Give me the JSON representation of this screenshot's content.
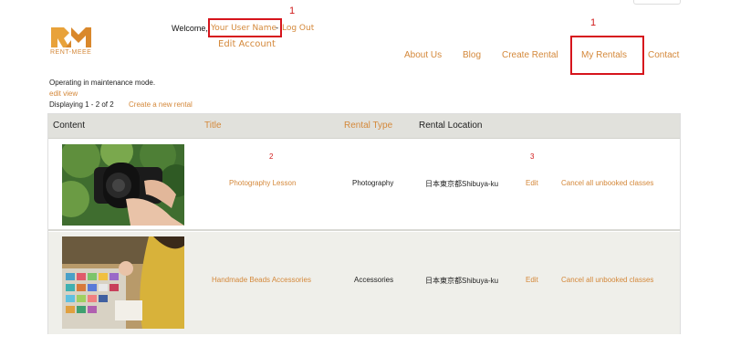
{
  "brand": {
    "logo_text": "RENT-MEEE"
  },
  "header": {
    "welcome_prefix": "Welcome,",
    "username": "Your User Name",
    "separator": "-",
    "logout": "Log Out",
    "edit_account": "Edit Account"
  },
  "annotations": {
    "marker_user": "1",
    "marker_my_rentals": "1",
    "marker_title": "2",
    "marker_edit": "3"
  },
  "nav": {
    "items": [
      "About Us",
      "Blog",
      "Create Rental",
      "My Rentals",
      "Contact"
    ]
  },
  "status": {
    "maintenance": "Operating in maintenance mode.",
    "edit_view": "edit view",
    "displaying": "Displaying 1 - 2 of 2",
    "create_link": "Create a new rental"
  },
  "table": {
    "headers": [
      "Content",
      "Title",
      "Rental Type",
      "Rental Location"
    ],
    "rows": [
      {
        "title": "Photography Lesson",
        "type": "Photography",
        "location": "日本東京都Shibuya-ku",
        "edit": "Edit",
        "cancel": "Cancel all unbooked classes"
      },
      {
        "title": "Handmade Beads Accessories",
        "type": "Accessories",
        "location": "日本東京都Shibuya-ku",
        "edit": "Edit",
        "cancel": "Cancel all unbooked classes"
      }
    ]
  },
  "colors": {
    "accent": "#d4883a",
    "annotation_red": "#d6141c",
    "header_bg": "#e1e1dc"
  }
}
